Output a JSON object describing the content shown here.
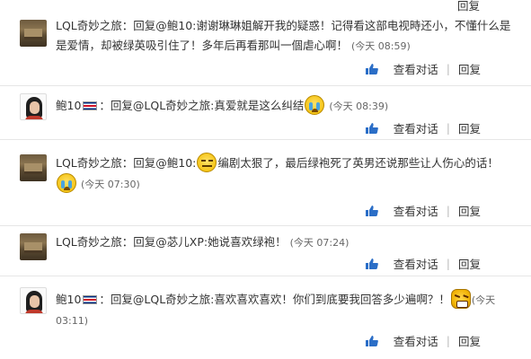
{
  "comments": [
    {
      "author": "LQL奇妙之旅",
      "text_line1": "：回复@鲍10:谢谢琳琳姐解开我的疑惑！记得看这部电视時还小，不懂什么是",
      "text_line2": "是爱情，却被绿英吸引住了！多年后再看那叫一個虐心啊！",
      "time": "(今天 08:59)",
      "avatar": "castle-avatar"
    },
    {
      "author": "鲍10",
      "text_line1": "：回复@LQL奇妙之旅:真爱就是这么纠结",
      "time": "(今天 08:39)",
      "emoji": "crying-emoji",
      "avatar": "woman-avatar"
    },
    {
      "author": "LQL奇妙之旅",
      "text_line1a": "：回复@鲍10:",
      "text_line1b": "编剧太狠了，最后绿袍死了英男还说那些让人伤心的话！",
      "time": "(今天 07:30)",
      "emoji1": "meh-emoji",
      "emoji2": "crying-emoji",
      "avatar": "castle-avatar"
    },
    {
      "author": "LQL奇妙之旅",
      "text_line1": "：回复@苾儿XP:她说喜欢绿袍！",
      "time": "(今天 07:24)",
      "avatar": "castle-avatar"
    },
    {
      "author": "鲍10",
      "text_line1": "：回复@LQL奇妙之旅:喜欢喜欢喜欢！你们到底要我回答多少遍啊？！",
      "time_line1": "(今天",
      "time_line2": "03:11)",
      "emoji": "angry-emoji",
      "avatar": "woman-avatar"
    }
  ],
  "actions": {
    "view_conversation": "查看对话",
    "separator": "|",
    "reply": "回复",
    "like_icon": "thumbs-up-icon"
  },
  "colors": {
    "link_blue": "#2b6ec7",
    "divider": "#e6e6e6"
  }
}
